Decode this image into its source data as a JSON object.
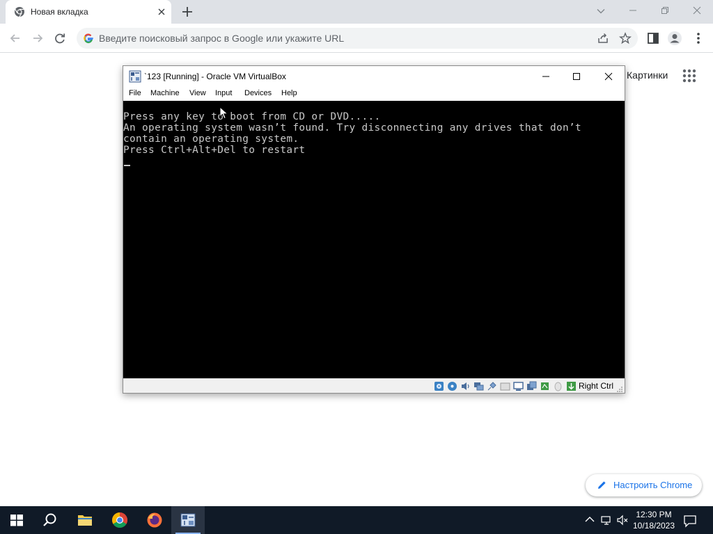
{
  "browser": {
    "tab": {
      "title": "Новая вкладка"
    },
    "omnibox": {
      "placeholder": "Введите поисковый запрос в Google или укажите URL"
    }
  },
  "ntp": {
    "images_link": "Картинки",
    "customize_button": "Настроить Chrome"
  },
  "vbox": {
    "title": "`123 [Running] - Oracle VM VirtualBox",
    "menu": [
      "File",
      "Machine",
      "View",
      "Input",
      "Devices",
      "Help"
    ],
    "console": [
      "Press any key to boot from CD or DVD.....",
      "An operating system wasn’t found. Try disconnecting any drives that don’t",
      "contain an operating system.",
      "Press Ctrl+Alt+Del to restart"
    ],
    "status_icons": [
      "hard-disk-icon",
      "optical-drive-icon",
      "audio-icon",
      "network-icon",
      "usb-icon",
      "shared-folders-icon",
      "display-icon",
      "recording-icon",
      "cpu-icon",
      "mouse-integration-icon",
      "keyboard-capture-icon"
    ],
    "host_key": "Right Ctrl"
  },
  "taskbar": {
    "apps": [
      "start-icon",
      "search-icon",
      "file-explorer-icon",
      "chrome-icon",
      "firefox-icon",
      "virtualbox-icon"
    ],
    "time": "12:30 PM",
    "date": "10/18/2023"
  },
  "colors": {
    "tabstrip": "#dee1e6",
    "omnibox": "#f1f3f4",
    "link_blue": "#1a73e8",
    "console_bg": "#000000",
    "console_text": "#c8c8c8",
    "taskbar": "#101a27"
  }
}
